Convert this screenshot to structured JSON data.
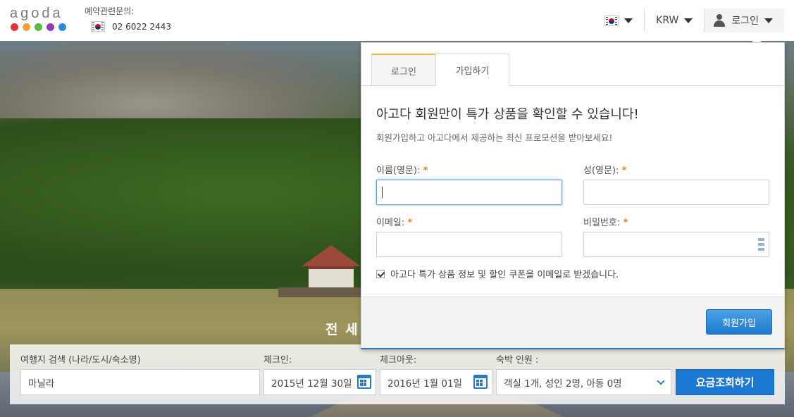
{
  "header": {
    "logo_text": "agoda",
    "logo_dot_colors": [
      "#e8323c",
      "#f4a13a",
      "#5cb946",
      "#8d3fae",
      "#2a8ddc"
    ],
    "contact_label": "예약관련문의:",
    "contact_phone": "02 6022 2443",
    "language_flag": "korea-flag",
    "currency": "KRW",
    "login_label": "로그인"
  },
  "popup": {
    "tabs": [
      {
        "label": "로그인",
        "active": false
      },
      {
        "label": "가입하기",
        "active": true
      }
    ],
    "heading": "아고다 회원만이 특가 상품을 확인할 수 있습니다!",
    "subheading": "회원가입하고 아고다에서 제공하는 최신 프로모션을 받아보세요!",
    "fields": {
      "first_name_label": "이름(영문):",
      "last_name_label": "성(영문):",
      "email_label": "이메일:",
      "password_label": "비밀번호:",
      "required_mark": "*"
    },
    "newsletter_label": "아고다 특가 상품 정보 및 할인 쿠폰을 이메일로 받겠습니다.",
    "newsletter_checked": true,
    "signup_button": "회원가입"
  },
  "hero": {
    "tagline": "전 세"
  },
  "search": {
    "destination_label": "여행지 검색 (나라/도시/숙소명)",
    "destination_value": "마닐라",
    "checkin_label": "체크인:",
    "checkin_value": "2015년 12월 30일",
    "checkout_label": "체크아웃:",
    "checkout_value": "2016년 1월 01일",
    "guests_label": "숙박 인원 :",
    "guests_value": "객실 1개, 성인 2명, 아동 0명",
    "search_button": "요금조회하기"
  },
  "colors": {
    "accent": "#1b79d4",
    "required": "#e87b1f",
    "tab_highlight": "#f0c050"
  }
}
